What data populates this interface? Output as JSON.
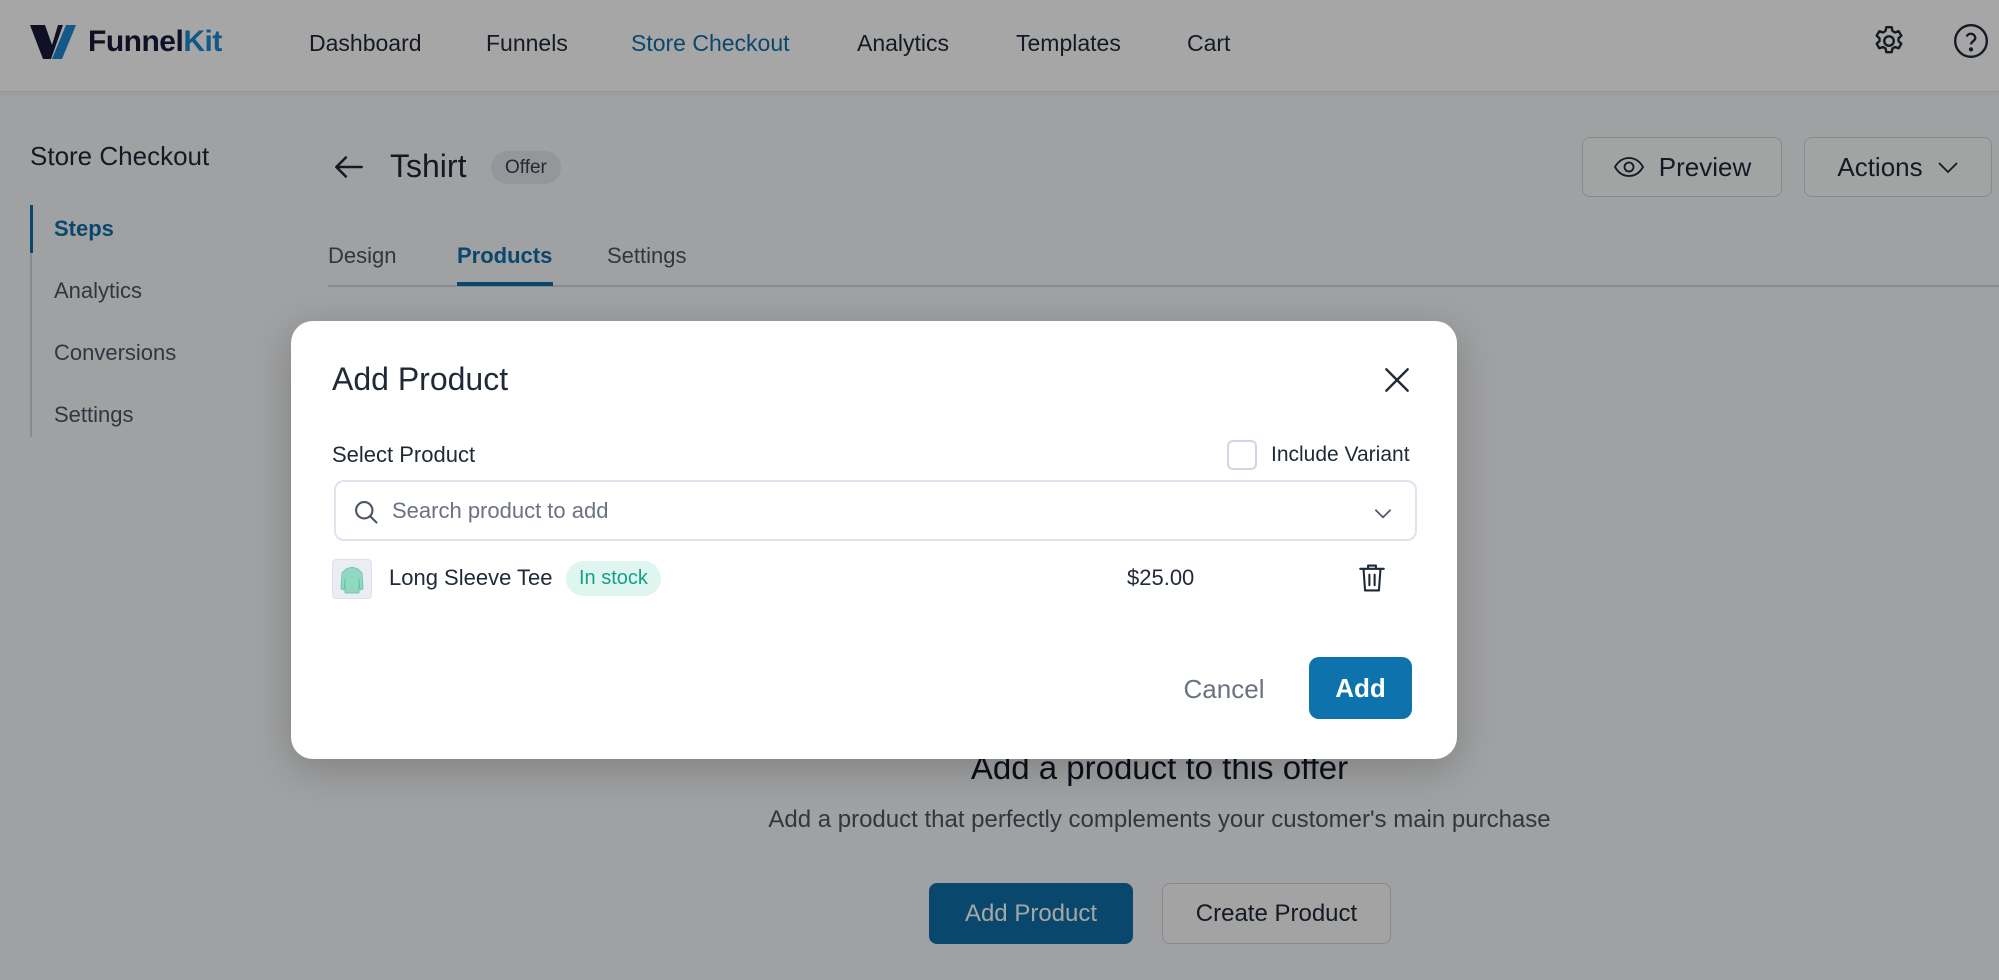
{
  "brand": {
    "name_part1": "Funnel",
    "name_part2": "Kit",
    "colors": {
      "dark": "#1a1a3a",
      "accent": "#1e88d0"
    }
  },
  "topnav": {
    "items": [
      {
        "label": "Dashboard",
        "active": false
      },
      {
        "label": "Funnels",
        "active": false
      },
      {
        "label": "Store Checkout",
        "active": true
      },
      {
        "label": "Analytics",
        "active": false
      },
      {
        "label": "Templates",
        "active": false
      },
      {
        "label": "Cart",
        "active": false
      }
    ],
    "icons": [
      "gear-icon",
      "help-icon"
    ]
  },
  "sidebar": {
    "title": "Store Checkout",
    "items": [
      {
        "label": "Steps",
        "active": true
      },
      {
        "label": "Analytics",
        "active": false
      },
      {
        "label": "Conversions",
        "active": false
      },
      {
        "label": "Settings",
        "active": false
      }
    ]
  },
  "header": {
    "title": "Tshirt",
    "badge": "Offer",
    "preview_label": "Preview",
    "actions_label": "Actions"
  },
  "tabs": [
    {
      "label": "Design",
      "active": false
    },
    {
      "label": "Products",
      "active": true
    },
    {
      "label": "Settings",
      "active": false
    }
  ],
  "empty_state": {
    "title": "Add a product to this offer",
    "subtitle": "Add a product that perfectly complements your customer's main purchase",
    "add_product_label": "Add Product",
    "create_product_label": "Create Product"
  },
  "modal": {
    "title": "Add Product",
    "select_label": "Select Product",
    "include_variant_label": "Include Variant",
    "include_variant_checked": false,
    "search": {
      "placeholder": "Search product to add",
      "value": ""
    },
    "products": [
      {
        "name": "Long Sleeve Tee",
        "stock_status": "In stock",
        "price": "$25.00"
      }
    ],
    "cancel_label": "Cancel",
    "add_label": "Add"
  },
  "colors": {
    "primary": "#0e73ac",
    "active_text": "#0f6fa6",
    "stock_badge_bg": "#dff5ef",
    "stock_badge_text": "#16a085"
  }
}
